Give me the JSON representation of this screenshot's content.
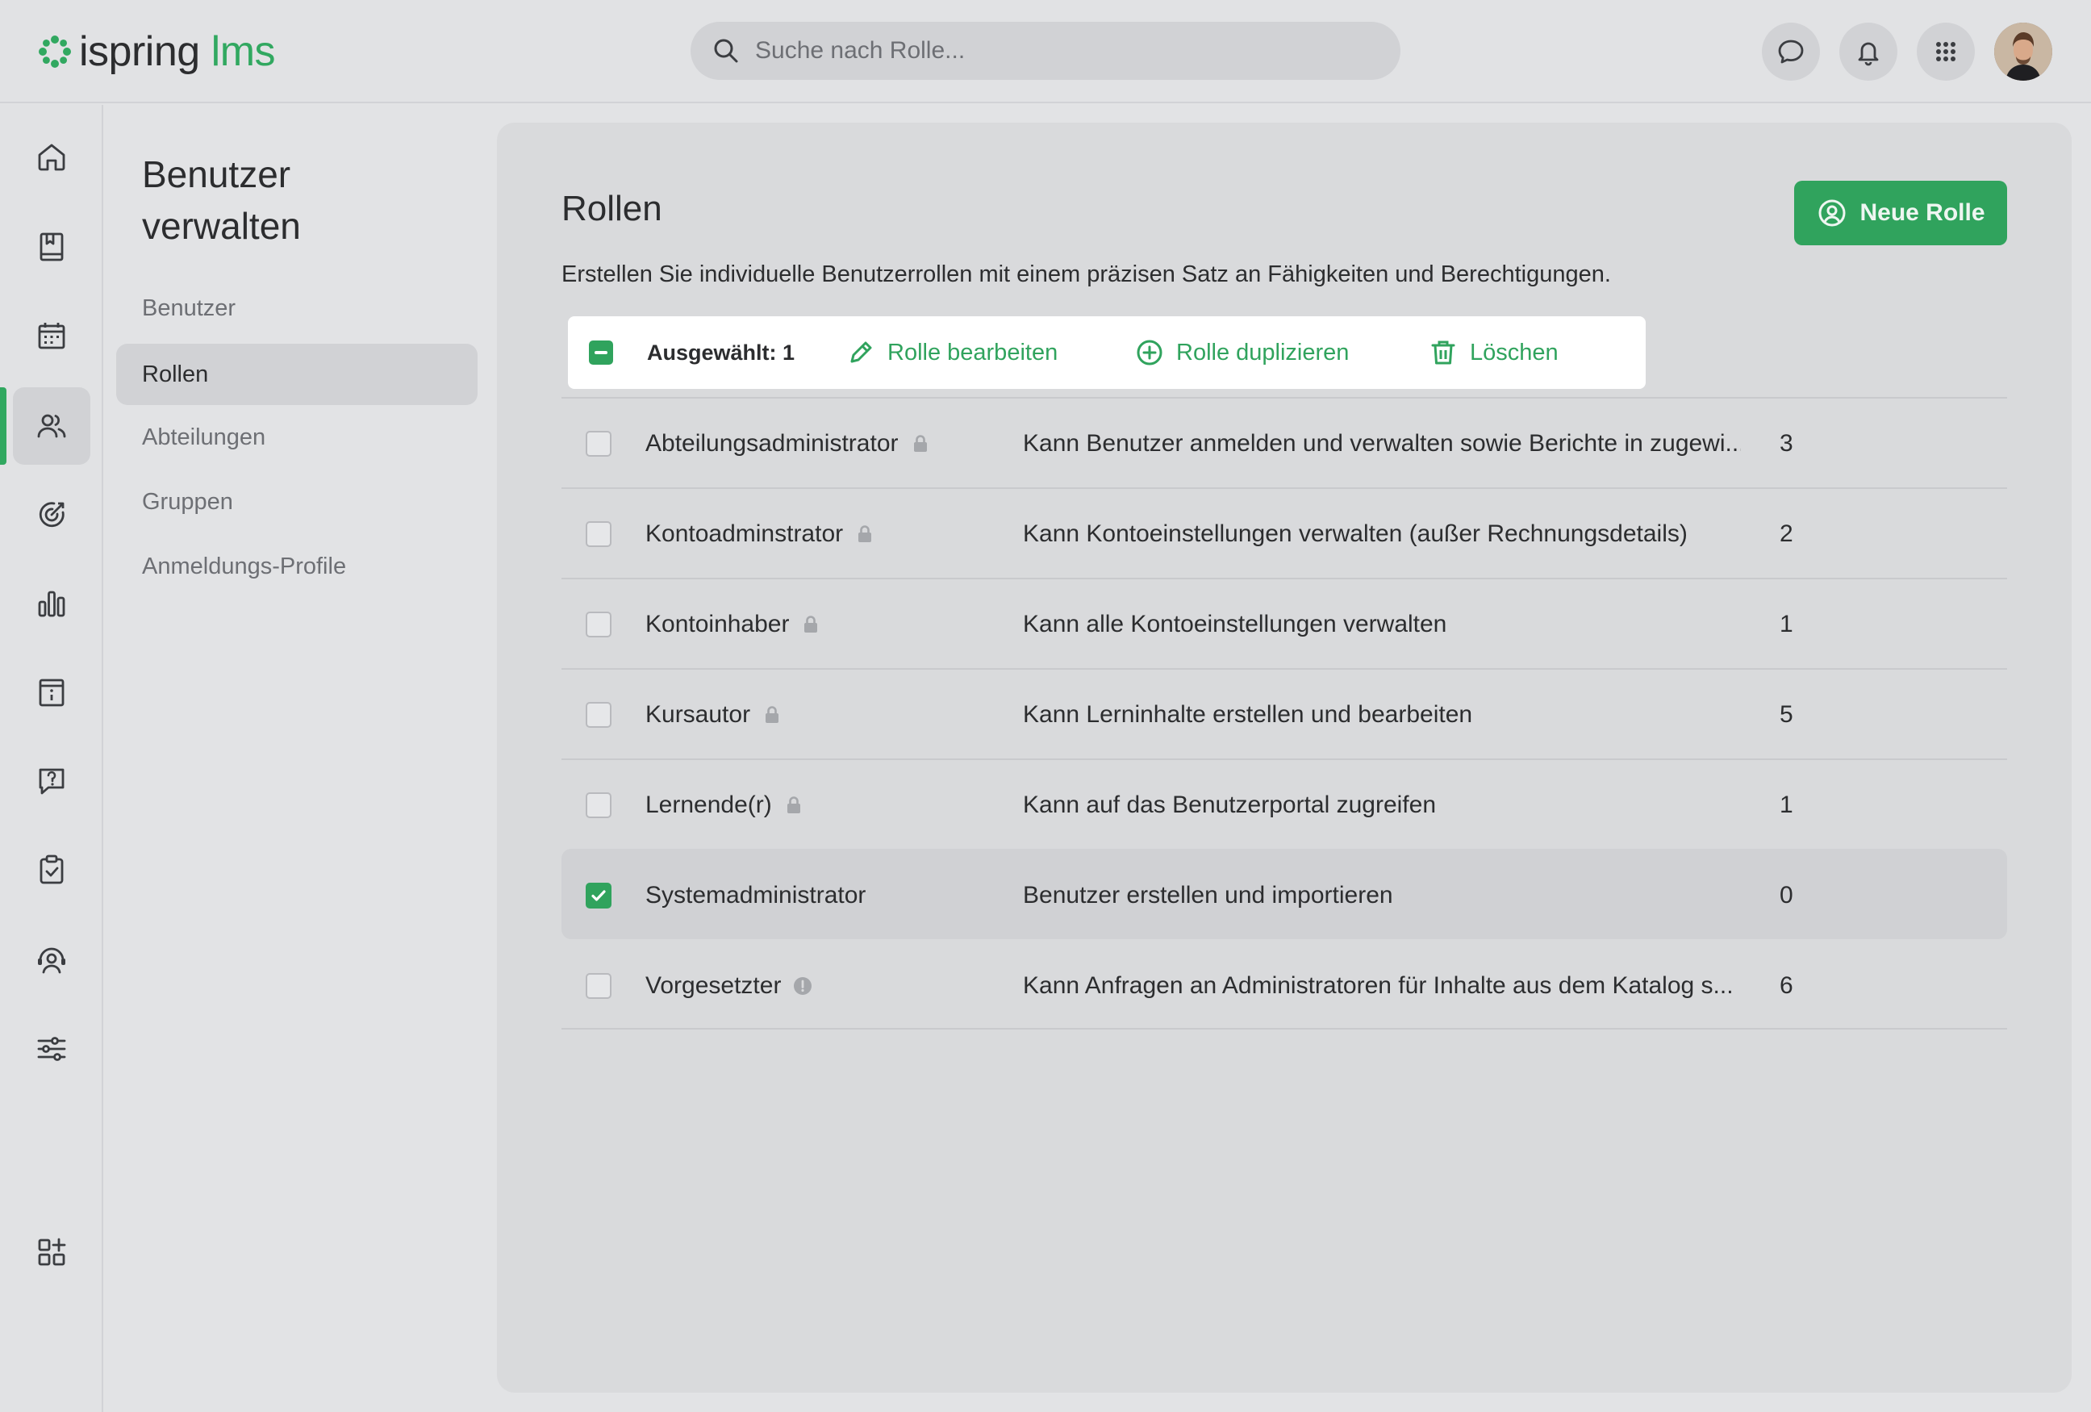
{
  "brand": {
    "name_a": "ispring",
    "name_b": "lms",
    "accent": "#31a860"
  },
  "search": {
    "placeholder": "Suche nach Rolle..."
  },
  "topbar": {
    "icons": [
      "chat-icon",
      "bell-icon",
      "apps-grid-icon",
      "user-avatar"
    ]
  },
  "rail": {
    "items": [
      "home-icon",
      "book-icon",
      "calendar-icon",
      "users-icon",
      "target-icon",
      "chart-icon",
      "info-board-icon",
      "question-icon",
      "clipboard-check-icon",
      "support-user-icon",
      "sliders-icon",
      "add-widget-icon"
    ],
    "active": "users-icon"
  },
  "subnav": {
    "title": "Benutzer verwalten",
    "items": [
      {
        "label": "Benutzer",
        "active": false
      },
      {
        "label": "Rollen",
        "active": true
      },
      {
        "label": "Abteilungen",
        "active": false
      },
      {
        "label": "Gruppen",
        "active": false
      },
      {
        "label": "Anmeldungs-Profile",
        "active": false
      }
    ]
  },
  "main": {
    "title": "Rollen",
    "description": "Erstellen Sie individuelle Benutzerrollen mit einem präzisen Satz an Fähigkeiten und Berechtigungen.",
    "new_button": "Neue Rolle",
    "selection": {
      "count_label": "Ausgewählt: 1",
      "edit": "Rolle bearbeiten",
      "duplicate": "Rolle duplizieren",
      "delete": "Löschen"
    },
    "roles": [
      {
        "name": "Abteilungsadministrator",
        "icon": "lock-icon",
        "description": "Kann Benutzer anmelden und verwalten sowie Berichte in zugewi...",
        "count": "3",
        "checked": false
      },
      {
        "name": "Kontoadminstrator",
        "icon": "lock-icon",
        "description": "Kann Kontoeinstellungen verwalten (außer Rechnungsdetails)",
        "count": "2",
        "checked": false
      },
      {
        "name": "Kontoinhaber",
        "icon": "lock-icon",
        "description": "Kann alle Kontoeinstellungen verwalten",
        "count": "1",
        "checked": false
      },
      {
        "name": "Kursautor",
        "icon": "lock-icon",
        "description": "Kann Lerninhalte erstellen und bearbeiten",
        "count": "5",
        "checked": false
      },
      {
        "name": "Lernende(r)",
        "icon": "lock-icon",
        "description": "Kann auf das Benutzerportal zugreifen",
        "count": "1",
        "checked": false
      },
      {
        "name": "Systemadministrator",
        "icon": "",
        "description": "Benutzer erstellen und importieren",
        "count": "0",
        "checked": true
      },
      {
        "name": "Vorgesetzter",
        "icon": "warning-icon",
        "description": "Kann Anfragen an Administratoren für Inhalte aus dem Katalog s...",
        "count": "6",
        "checked": false
      }
    ]
  }
}
